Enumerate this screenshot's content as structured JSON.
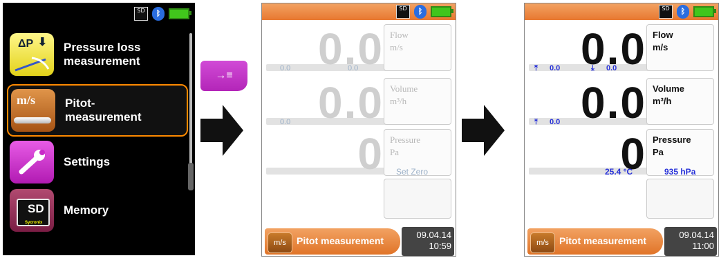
{
  "status": {
    "sd_label": "SD"
  },
  "menu": {
    "items": [
      {
        "label": "Pressure loss measurement",
        "icon": "pressure-loss-icon",
        "icon_text": "ΔP"
      },
      {
        "label": "Pitot- measurement",
        "icon": "pitot-icon",
        "icon_text": "m/s",
        "selected": true
      },
      {
        "label": "Settings",
        "icon": "wrench-icon"
      },
      {
        "label": "Memory",
        "icon": "sd-card-icon",
        "icon_text": "SD",
        "icon_subtext": "Sycronix"
      }
    ]
  },
  "enter_button": {
    "icon": "enter-icon",
    "glyph": "→≡"
  },
  "screen_idle": {
    "flow": {
      "value": "0.0",
      "label": "Flow",
      "unit": "m/s",
      "sub_left": "0.0",
      "sub_right": "0.0"
    },
    "volume": {
      "value": "0.0",
      "label": "Volume",
      "unit": "m³/h",
      "sub_left": "0.0"
    },
    "pressure": {
      "value": "0",
      "label": "Pressure",
      "unit": "Pa",
      "action": "Set Zero"
    },
    "bottom": {
      "mode_label": "Pitot measurement",
      "icon_text": "m/s",
      "date": "09.04.14",
      "time": "10:59"
    }
  },
  "screen_active": {
    "flow": {
      "value": "0.0",
      "label": "Flow",
      "unit": "m/s",
      "max_value": "0.0",
      "min_value": "0.0"
    },
    "volume": {
      "value": "0.0",
      "label": "Volume",
      "unit": "m³/h",
      "max_value": "0.0"
    },
    "pressure": {
      "value": "0",
      "label": "Pressure",
      "unit": "Pa",
      "temperature": "25.4 °C",
      "ambient_pressure": "935 hPa"
    },
    "bottom": {
      "mode_label": "Pitot measurement",
      "icon_text": "m/s",
      "date": "09.04.14",
      "time": "11:00"
    }
  },
  "colors": {
    "accent_orange": "#e87830",
    "menu_selected_border": "#ff8a00",
    "blue_values": "#2630d8",
    "enter_purple": "#c03ac6"
  }
}
